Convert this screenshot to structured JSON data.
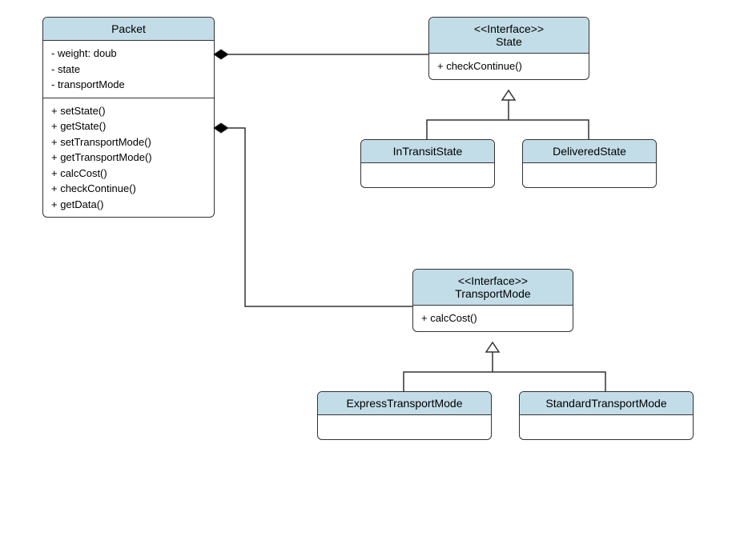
{
  "classes": {
    "packet": {
      "name": "Packet",
      "attributes": [
        "- weight: doub",
        "- state",
        "- transportMode"
      ],
      "methods": [
        "+ setState()",
        "+ getState()",
        "+ setTransportMode()",
        "+ getTransportMode()",
        "+ calcCost()",
        "+ checkContinue()",
        "+ getData()"
      ]
    },
    "state": {
      "stereotype": "<<Interface>>",
      "name": "State",
      "methods": [
        "+ checkContinue()"
      ]
    },
    "inTransitState": {
      "name": "InTransitState"
    },
    "deliveredState": {
      "name": "DeliveredState"
    },
    "transportMode": {
      "stereotype": "<<Interface>>",
      "name": "TransportMode",
      "methods": [
        "+ calcCost()"
      ]
    },
    "expressTransportMode": {
      "name": "ExpressTransportMode"
    },
    "standardTransportMode": {
      "name": "StandardTransportMode"
    }
  }
}
